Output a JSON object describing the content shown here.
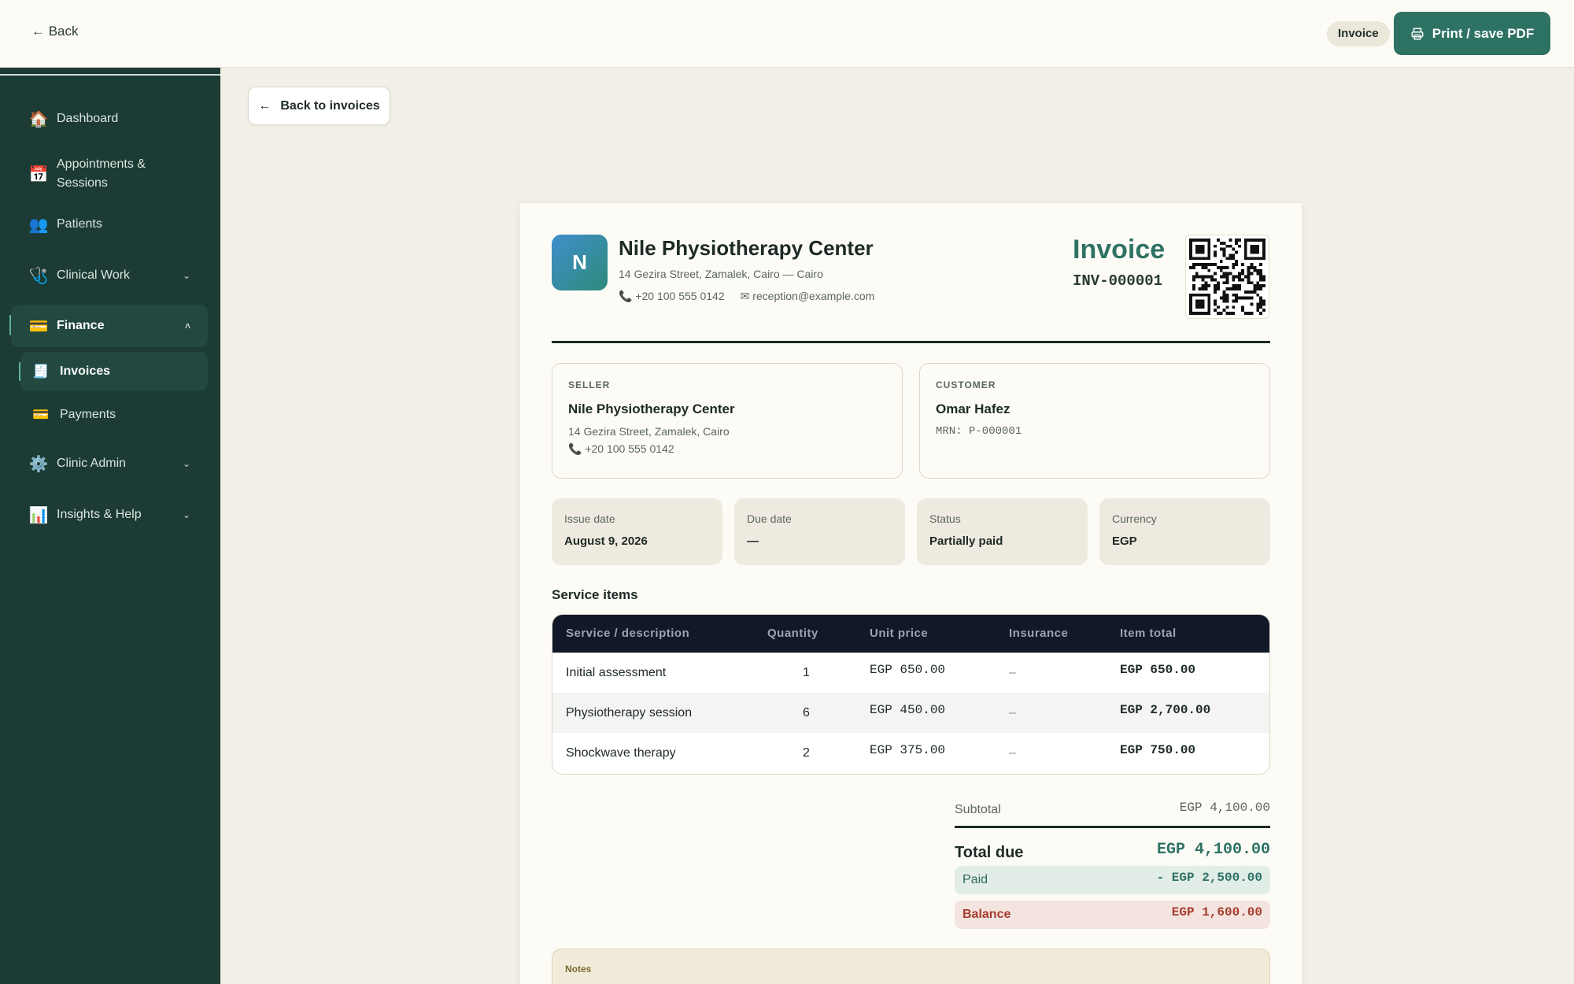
{
  "topbar": {
    "back_label": "← Back",
    "badge": "Invoice",
    "print_label": "Print / save PDF"
  },
  "sidebar": {
    "items": [
      {
        "label": "Dashboard",
        "icon": "🏠"
      },
      {
        "label": "Appointments &",
        "label2": "Sessions",
        "icon": "📅"
      },
      {
        "label": "Patients",
        "icon": "👥"
      },
      {
        "label": "Clinical Work",
        "icon": "🩺"
      },
      {
        "label": "Finance",
        "icon": "💳"
      },
      {
        "label": "Clinic Admin",
        "icon": "⚙️"
      },
      {
        "label": "Insights & Help",
        "icon": "📊"
      }
    ],
    "sub_items": [
      {
        "label": "Invoices",
        "icon": "🧾"
      },
      {
        "label": "Payments",
        "icon": "💳"
      }
    ]
  },
  "back_to_invoices": "Back to invoices",
  "invoice": {
    "logo_letter": "N",
    "clinic_name": "Nile Physiotherapy Center",
    "clinic_address": "14 Gezira Street, Zamalek, Cairo — Cairo",
    "clinic_phone": "📞 +20 100 555 0142",
    "clinic_email": "✉ reception@example.com",
    "title": "Invoice",
    "number": "INV-000001",
    "seller": {
      "label": "SELLER",
      "name": "Nile Physiotherapy Center",
      "address": "14 Gezira Street, Zamalek, Cairo",
      "phone": "📞 +20 100 555 0142"
    },
    "customer": {
      "label": "CUSTOMER",
      "name": "Omar Hafez",
      "mrn": "MRN: P-000001"
    },
    "meta": [
      {
        "label": "Issue date",
        "value": "August 9, 2026"
      },
      {
        "label": "Due date",
        "value": "—"
      },
      {
        "label": "Status",
        "value": "Partially paid"
      },
      {
        "label": "Currency",
        "value": "EGP"
      }
    ],
    "items_title": "Service items",
    "table": {
      "headers": [
        "Service / description",
        "Quantity",
        "Unit price",
        "Insurance",
        "Item total"
      ],
      "rows": [
        {
          "service": "Initial assessment",
          "qty": "1",
          "unit": "EGP 650.00",
          "insurance": "–",
          "total": "EGP 650.00"
        },
        {
          "service": "Physiotherapy session",
          "qty": "6",
          "unit": "EGP 450.00",
          "insurance": "–",
          "total": "EGP 2,700.00"
        },
        {
          "service": "Shockwave therapy",
          "qty": "2",
          "unit": "EGP 375.00",
          "insurance": "–",
          "total": "EGP 750.00"
        }
      ]
    },
    "summary": {
      "subtotal_label": "Subtotal",
      "subtotal": "EGP 4,100.00",
      "total_label": "Total due",
      "total": "EGP 4,100.00",
      "paid_label": "Paid",
      "paid": "- EGP 2,500.00",
      "balance_label": "Balance",
      "balance": "EGP 1,600.00"
    },
    "notes_label": "Notes"
  }
}
